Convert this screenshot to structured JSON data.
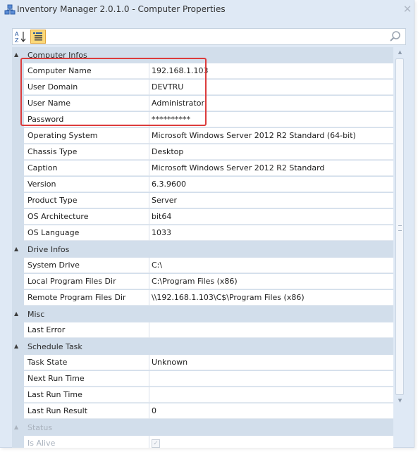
{
  "window": {
    "title": "Inventory Manager 2.0.1.0 - Computer Properties"
  },
  "categories": [
    {
      "label": "Computer Infos",
      "properties": [
        {
          "name": "Computer Name",
          "value": "192.168.1.103"
        },
        {
          "name": "User Domain",
          "value": "DEVTRU"
        },
        {
          "name": "User Name",
          "value": "Administrator"
        },
        {
          "name": "Password",
          "value": "**********"
        },
        {
          "name": "Operating System",
          "value": "Microsoft Windows Server 2012 R2 Standard (64-bit)"
        },
        {
          "name": "Chassis Type",
          "value": "Desktop"
        },
        {
          "name": "Caption",
          "value": "Microsoft Windows Server 2012 R2 Standard"
        },
        {
          "name": "Version",
          "value": "6.3.9600"
        },
        {
          "name": "Product Type",
          "value": "Server"
        },
        {
          "name": "OS Architecture",
          "value": "bit64"
        },
        {
          "name": "OS Language",
          "value": "1033"
        }
      ]
    },
    {
      "label": "Drive Infos",
      "properties": [
        {
          "name": "System Drive",
          "value": "C:\\"
        },
        {
          "name": "Local Program Files Dir",
          "value": "C:\\Program Files (x86)"
        },
        {
          "name": "Remote Program Files Dir",
          "value": "\\\\192.168.1.103\\C$\\Program Files (x86)"
        }
      ]
    },
    {
      "label": "Misc",
      "properties": [
        {
          "name": "Last Error",
          "value": ""
        }
      ]
    },
    {
      "label": "Schedule Task",
      "properties": [
        {
          "name": "Task State",
          "value": "Unknown"
        },
        {
          "name": "Next Run Time",
          "value": ""
        },
        {
          "name": "Last Run Time",
          "value": ""
        },
        {
          "name": "Last Run Result",
          "value": "0"
        }
      ]
    },
    {
      "label": "Status",
      "properties": [
        {
          "name": "Is Alive",
          "value": "",
          "checkbox": true,
          "checked": true
        }
      ]
    }
  ],
  "colors": {
    "highlight": "#dc3c3c",
    "category_background": "#d2deeb",
    "window_background": "#dfe9f5",
    "active_toolbar_button": "#fbd878"
  },
  "icons": {
    "app": "network-computers-icon",
    "sort": "sort-alphabetical-icon",
    "categorized": "categorized-view-icon",
    "search": "search-icon",
    "close": "close-icon"
  }
}
